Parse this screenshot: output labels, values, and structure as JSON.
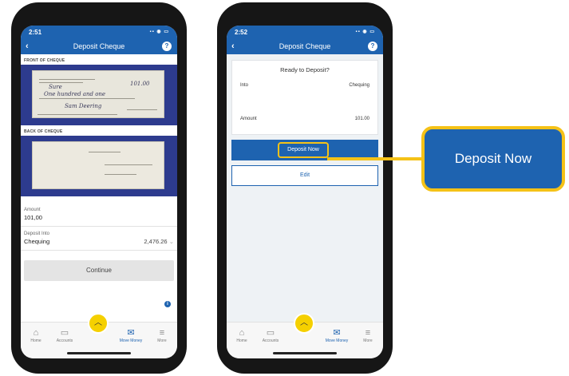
{
  "phone1": {
    "status_time": "2:51",
    "header_title": "Deposit Cheque",
    "front_label": "FRONT OF CHEQUE",
    "back_label": "BACK OF CHEQUE",
    "amount_label": "Amount",
    "amount_value": "101,00",
    "deposit_into_label": "Deposit Into",
    "deposit_into_value": "Chequing",
    "balance": "2,476.26",
    "continue_label": "Continue"
  },
  "phone2": {
    "status_time": "2:52",
    "header_title": "Deposit Cheque",
    "ready_text": "Ready to Deposit?",
    "into_label": "Into",
    "into_value": "Chequing",
    "amount_label": "Amount",
    "amount_value": "101.00",
    "deposit_now_label": "Deposit Now",
    "edit_label": "Edit"
  },
  "nav": {
    "home": "Home",
    "accounts": "Accounts",
    "move_money": "Move Money",
    "more": "More"
  },
  "callout": {
    "label": "Deposit Now"
  },
  "colors": {
    "brand_blue": "#1e63b0",
    "highlight_yellow": "#f5c217"
  }
}
